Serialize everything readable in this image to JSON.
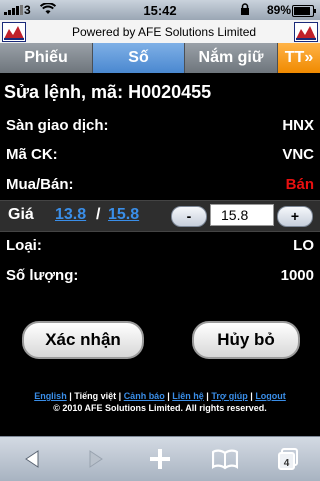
{
  "status_bar": {
    "carrier": "3",
    "time": "15:42",
    "battery_text": "89%",
    "battery_level": 0.89
  },
  "banner": {
    "text": "Powered by AFE Solutions Limited"
  },
  "tabs": [
    {
      "label": "Phiếu",
      "active": false
    },
    {
      "label": "Số",
      "active": true
    },
    {
      "label": "Nắm giữ",
      "active": false
    },
    {
      "label": "TT»",
      "active": false
    }
  ],
  "heading": "Sửa lệnh, mã: H0020455",
  "fields": {
    "exchange": {
      "label": "Sàn giao dịch:",
      "value": "HNX"
    },
    "symbol": {
      "label": "Mã CK:",
      "value": "VNC"
    },
    "side": {
      "label": "Mua/Bán:",
      "value": "Bán"
    },
    "type": {
      "label": "Loại:",
      "value": "LO"
    },
    "quantity": {
      "label": "Số lượng:",
      "value": "1000"
    }
  },
  "price": {
    "label": "Giá",
    "low": "13.8",
    "separator": "/",
    "high": "15.8",
    "minus": "-",
    "plus": "+",
    "value": "15.8"
  },
  "actions": {
    "confirm": "Xác nhận",
    "cancel": "Hủy bỏ"
  },
  "footer": {
    "links": [
      "English",
      "Tiếng việt",
      "Cảnh báo",
      "Liên hệ",
      "Trợ giúp",
      "Logout"
    ],
    "separator": "|",
    "copyright": "© 2010 AFE Solutions Limited. All rights reserved."
  },
  "toolbar": {
    "icons": [
      "back-icon",
      "forward-icon",
      "add-icon",
      "bookmarks-icon",
      "pages-icon"
    ],
    "pages_count": "4"
  },
  "colors": {
    "active_tab": "#4a88d0",
    "more_tab": "#f08a00",
    "sell": "#e81010",
    "link": "#3a8ee8"
  }
}
